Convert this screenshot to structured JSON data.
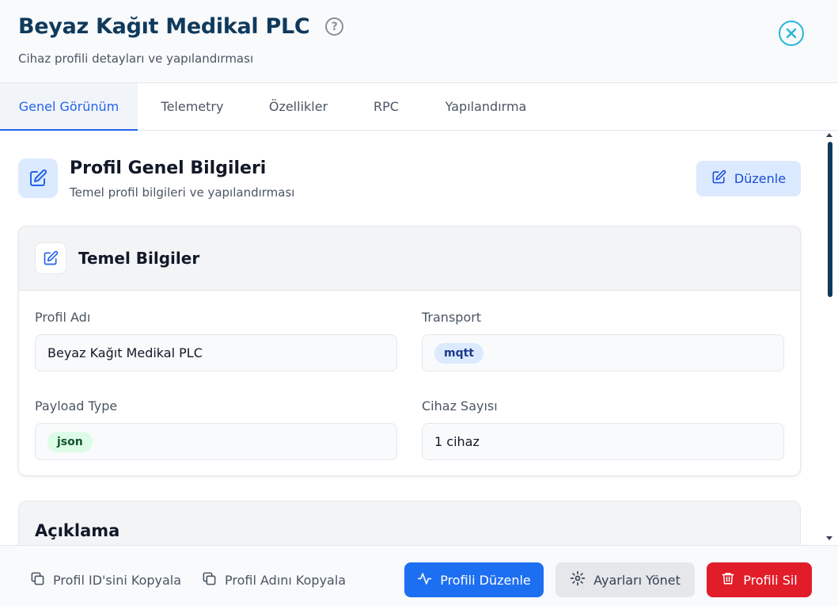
{
  "header": {
    "title": "Beyaz Kağıt Medikal PLC",
    "subtitle": "Cihaz profili detayları ve yapılandırması"
  },
  "tabs": [
    {
      "label": "Genel Görünüm",
      "active": true
    },
    {
      "label": "Telemetry",
      "active": false
    },
    {
      "label": "Özellikler",
      "active": false
    },
    {
      "label": "RPC",
      "active": false
    },
    {
      "label": "Yapılandırma",
      "active": false
    }
  ],
  "section": {
    "title": "Profil Genel Bilgileri",
    "subtitle": "Temel profil bilgileri ve yapılandırması",
    "edit_label": "Düzenle"
  },
  "basic_card": {
    "title": "Temel Bilgiler",
    "profile_name_label": "Profil Adı",
    "profile_name_value": "Beyaz Kağıt Medikal PLC",
    "transport_label": "Transport",
    "transport_value": "mqtt",
    "payload_label": "Payload Type",
    "payload_value": "json",
    "device_count_label": "Cihaz Sayısı",
    "device_count_value": "1 cihaz"
  },
  "description_card": {
    "title": "Açıklama"
  },
  "footer": {
    "copy_id_label": "Profil ID'sini Kopyala",
    "copy_name_label": "Profil Adını Kopyala",
    "edit_profile_label": "Profili Düzenle",
    "manage_settings_label": "Ayarları Yönet",
    "delete_profile_label": "Profili Sil"
  },
  "colors": {
    "accent": "#1d6ff2",
    "danger": "#e11d2a",
    "title": "#0f3a5c"
  }
}
